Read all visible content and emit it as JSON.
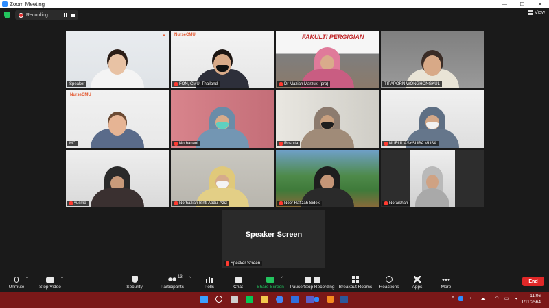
{
  "window": {
    "title": "Zoom Meeting",
    "minimize": "—",
    "maximize": "☐",
    "close": "✕"
  },
  "topbar": {
    "recording_label": "Recording...",
    "view_label": "View"
  },
  "participants": [
    {
      "name": "Speaker"
    },
    {
      "name": "FON, CMU, Thailand"
    },
    {
      "name": "Dr Maziah Marzuki (pro)"
    },
    {
      "name": "TIPAPORN WONGHONGKUL"
    },
    {
      "name": "MC"
    },
    {
      "name": "Norhanani"
    },
    {
      "name": "Rosnita"
    },
    {
      "name": "NURUL ASYSURA MUSA"
    },
    {
      "name": "yusma"
    },
    {
      "name": "Norhaziah Binti Abdul Aziz"
    },
    {
      "name": "Noor Hafizah Sidek"
    },
    {
      "name": "Noraishah"
    }
  ],
  "logos": {
    "nursecmu": "NurseCMU",
    "banner": "FAKULTI PERGIGIAN"
  },
  "speaker_screen": {
    "title": "Speaker Screen",
    "label": "Speaker Screen"
  },
  "toolbar": {
    "unmute": "Unmute",
    "stop_video": "Stop Video",
    "security": "Security",
    "participants": "Participants",
    "participants_count": "13",
    "polls": "Polls",
    "chat": "Chat",
    "share_screen": "Share Screen",
    "pause_recording": "Pause/Stop Recording",
    "breakout_rooms": "Breakout Rooms",
    "reactions": "Reactions",
    "apps": "Apps",
    "more": "More",
    "end": "End"
  },
  "clock": {
    "time": "11:06",
    "date": "1/11/2564"
  },
  "colors": {
    "active_speaker": "#c8e66a",
    "share_green": "#23c45e",
    "end_red": "#e02828",
    "taskbar": "#7a1818"
  }
}
